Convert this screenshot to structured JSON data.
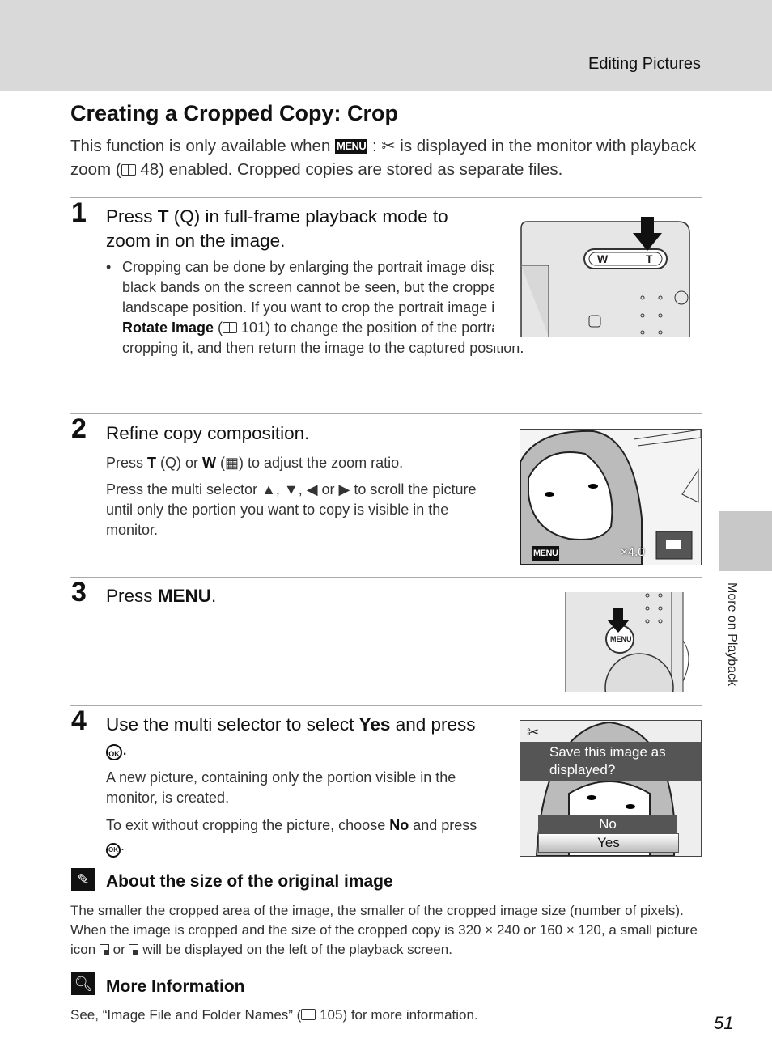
{
  "header": {
    "section": "Editing Pictures"
  },
  "title": "Creating a Cropped Copy: Crop",
  "intro": {
    "p1": "This function is only available when ",
    "menu_icon": "MENU",
    "p2": " : ",
    "p3": " is displayed in the monitor with playback zoom (",
    "ref": "48",
    "p4": ") enabled. Cropped copies are stored as separate files."
  },
  "steps": [
    {
      "number": "1",
      "title_a": "Press ",
      "title_b": "T",
      "title_c": " (Q) in full-frame playback mode to zoom in on the image.",
      "bullet_a": "Cropping can be done by enlarging the portrait image displayed until the right and left black bands on the screen cannot be seen, but the cropped image is displayed in the landscape position. If you want to crop the portrait image in the captured position, use ",
      "bullet_b": "Rotate Image",
      "bullet_c": " (",
      "bullet_ref": "101",
      "bullet_d": ") to change the position of the portrait image to landscape before cropping it, and then return the image to the captured position.",
      "illus": {
        "w": "W",
        "t": "T"
      }
    },
    {
      "number": "2",
      "title": "Refine copy composition.",
      "p1_a": "Press ",
      "p1_b": "T",
      "p1_c": " (Q) or ",
      "p1_d": "W",
      "p1_e": " (▦) to adjust the zoom ratio.",
      "p2": "Press the multi selector ▲, ▼, ◀ or ▶ to scroll the picture until only the portion you want to copy is visible in the monitor.",
      "illus": {
        "menu": "MENU",
        "zoom": "×4.0"
      }
    },
    {
      "number": "3",
      "title_a": "Press ",
      "title_b": "MENU",
      "title_c": ".",
      "illus": {
        "button": "MENU"
      }
    },
    {
      "number": "4",
      "title_a": "Use the multi selector to select ",
      "title_b": "Yes",
      "title_c": " and press",
      "p1": "A new picture, containing only the portion visible in the monitor, is created.",
      "p2_a": "To exit without cropping the picture, choose ",
      "p2_b": "No",
      "p2_c": " and press",
      "ok": "OK",
      "illus": {
        "prompt": "Save this image as displayed?",
        "options": [
          "No",
          "Yes"
        ],
        "selected": "Yes"
      }
    }
  ],
  "notes": [
    {
      "icon": "pencil-icon",
      "title": "About the size of the original image",
      "text_a": "The smaller the cropped area of the image, the smaller of the cropped image size (number of pixels). When the image is cropped and the size of the cropped copy is 320 × 240 or 160 × 120, a small picture icon ",
      "text_b": " or ",
      "text_c": " will be displayed on the left of the playback screen."
    },
    {
      "icon": "magnifier-icon",
      "title": "More Information",
      "text_a": "See, “Image File and Folder Names” (",
      "ref": "105",
      "text_b": ") for more information."
    }
  ],
  "sidebar": {
    "label": "More on Playback"
  },
  "page_number": "51"
}
